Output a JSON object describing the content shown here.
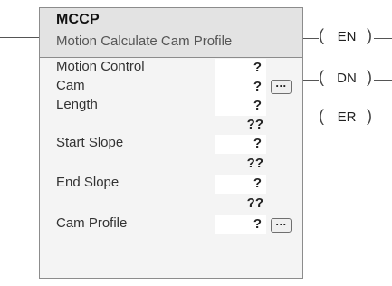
{
  "instruction": {
    "mnemonic": "MCCP",
    "description": "Motion Calculate Cam Profile"
  },
  "operands": [
    {
      "label": "Motion Control",
      "value": "?",
      "sub_value": "",
      "has_browse": false
    },
    {
      "label": "Cam",
      "value": "?",
      "sub_value": "",
      "has_browse": true
    },
    {
      "label": "Length",
      "value": "?",
      "sub_value": "??",
      "has_browse": false
    },
    {
      "label": "Start Slope",
      "value": "?",
      "sub_value": "??",
      "has_browse": false
    },
    {
      "label": "End Slope",
      "value": "?",
      "sub_value": "??",
      "has_browse": false
    },
    {
      "label": "Cam Profile",
      "value": "?",
      "sub_value": "",
      "has_browse": true
    }
  ],
  "browse_button_label": "...",
  "outputs": [
    {
      "label": "EN"
    },
    {
      "label": "DN"
    },
    {
      "label": "ER"
    }
  ],
  "coil_parens": {
    "left": "(",
    "right": ")"
  }
}
